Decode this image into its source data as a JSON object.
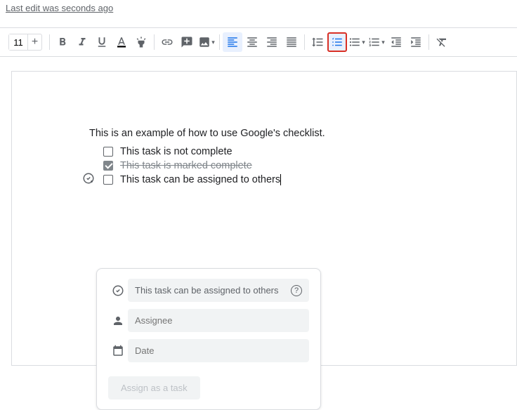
{
  "header": {
    "lastEdit": "Last edit was seconds ago"
  },
  "toolbar": {
    "fontSize": "11"
  },
  "doc": {
    "intro": "This is an example of how to use Google's checklist.",
    "items": [
      {
        "text": "This task is not complete"
      },
      {
        "text": "This task is marked complete"
      },
      {
        "text": "This task can be assigned to others"
      }
    ]
  },
  "taskPanel": {
    "title": "This task can be assigned to others",
    "assignee": "Assignee",
    "date": "Date",
    "button": "Assign as a task"
  }
}
